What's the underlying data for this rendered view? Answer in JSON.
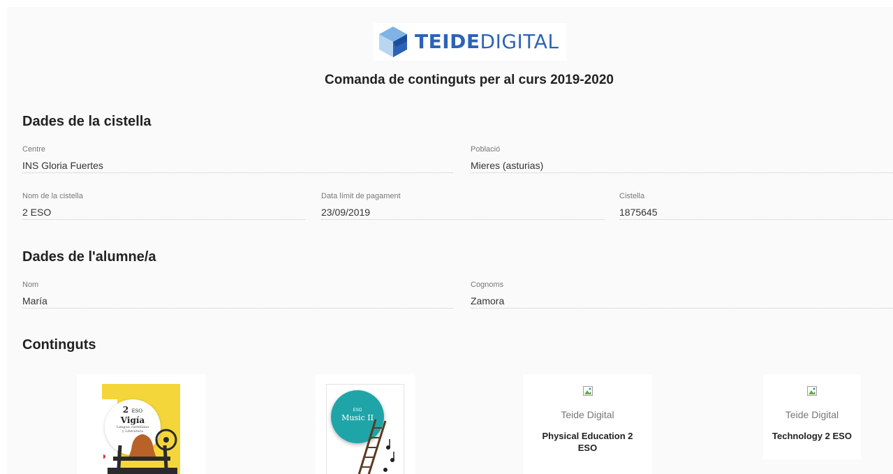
{
  "header": {
    "logo": {
      "part1": "TEIDE",
      "part2": "DIGITAL",
      "icon": "cube-logo-icon"
    },
    "title": "Comanda de continguts per al curs 2019-2020"
  },
  "basket": {
    "heading": "Dades de la cistella",
    "centre": {
      "label": "Centre",
      "value": "INS Gloria Fuertes"
    },
    "poblacio": {
      "label": "Població",
      "value": "Mieres (asturias)"
    },
    "nom_cistella": {
      "label": "Nom de la cistella",
      "value": "2 ESO"
    },
    "data_limit": {
      "label": "Data límit de pagament",
      "value": "23/09/2019"
    },
    "cistella": {
      "label": "Cistella",
      "value": "1875645"
    }
  },
  "student": {
    "heading": "Dades de l'alumne/a",
    "nom": {
      "label": "Nom",
      "value": "María"
    },
    "cognoms": {
      "label": "Cognoms",
      "value": "Zamora"
    }
  },
  "contents": {
    "heading": "Continguts",
    "products": [
      {
        "cover_type": "image",
        "cover": {
          "level": "2",
          "level_small": "ESO",
          "title": "Vigía",
          "subtitle_1": "Lengua castellana",
          "subtitle_2": "y Literatura",
          "accent": "#f5d63a"
        }
      },
      {
        "cover_type": "image",
        "cover": {
          "small": "ESO",
          "title": "Music II",
          "accent": "#1fa5a8"
        }
      },
      {
        "cover_type": "broken",
        "publisher": "Teide Digital",
        "title": "Physical Education 2 ESO"
      },
      {
        "cover_type": "broken",
        "publisher": "Teide Digital",
        "title": "Technology 2 ESO"
      }
    ]
  },
  "colors": {
    "brand_blue": "#2d63b7",
    "page_bg": "#fafafa"
  }
}
